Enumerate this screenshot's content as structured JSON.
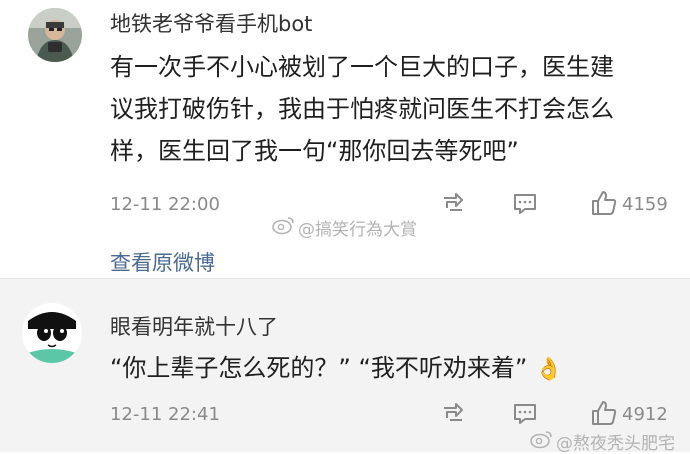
{
  "comments": [
    {
      "username": "地铁老爷爷看手机bot",
      "content_lines": [
        "有一次手不小心被划了一个巨大的口子，医生建",
        "议我打破伤针，我由于怕疼就问医生不打会怎么",
        "样，医生回了我一句“那你回去等死吧”"
      ],
      "time": "12-11 22:00",
      "likes": "4159",
      "view_original": "查看原微博",
      "watermark": "@搞笑行為大賞"
    },
    {
      "username": "眼看明年就十八了",
      "content": "“你上辈子怎么死的？” “我不听劝来着”",
      "content_emoji": "👌",
      "time": "12-11 22:41",
      "likes": "4912",
      "watermark": "@熬夜秃头肥宅"
    }
  ],
  "icons": {
    "repost": "repost-icon",
    "comment": "comment-icon",
    "like": "thumbs-up-icon",
    "weibo": "weibo-logo-icon"
  },
  "colors": {
    "link": "#4a6a92",
    "meta": "#8a8a8a",
    "second_card_bg": "#f3f3f3"
  }
}
